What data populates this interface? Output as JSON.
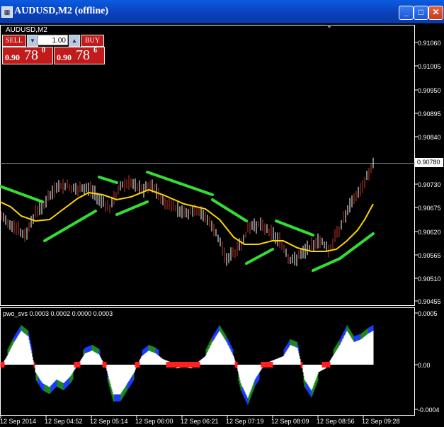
{
  "window": {
    "title": "AUDUSD,M2 (offline)",
    "minimize": "_",
    "maximize": "□",
    "close": "✕"
  },
  "symbol_label": "AUDUSD,M2",
  "one_click": {
    "sell_label": "SELL",
    "buy_label": "BUY",
    "lot": "1.00",
    "dropdown_icon": "▼",
    "up_icon": "▲",
    "sell_quote": {
      "big": "0.90",
      "pips": "78",
      "frac": "0"
    },
    "buy_quote": {
      "big": "0.90",
      "pips": "78",
      "frac": "6"
    }
  },
  "price_axis": [
    "0.91060",
    "0.91005",
    "0.90950",
    "0.90895",
    "0.90840",
    "0.90780",
    "0.90730",
    "0.90675",
    "0.90620",
    "0.90565",
    "0.90510",
    "0.90455"
  ],
  "current_price": "0.90780",
  "indicator": {
    "name": "pwo_svs 0.0003 0.0002 0.0000 0.0003",
    "axis": [
      "0.0005",
      "0.00",
      "-0.0004"
    ]
  },
  "time_axis": [
    "12 Sep 2014",
    "12 Sep 04:52",
    "12 Sep 05:14",
    "12 Sep 06:00",
    "12 Sep 06:21",
    "12 Sep 07:19",
    "12 Sep 08:09",
    "12 Sep 08:56",
    "12 Sep 09:28"
  ],
  "colors": {
    "candle": "#ffffff",
    "bear": "#c0392b",
    "ma": "#ffd400",
    "band": "#33dd33",
    "hist_pos": "#ffffff",
    "hist_red": "#ff2020",
    "hist_blue": "#1a3cff",
    "hist_green": "#1b8a1b"
  },
  "chart_data": [
    {
      "type": "line",
      "series": [
        {
          "values": [
            0.90675,
            0.90655,
            0.9064,
            0.907,
            0.9074,
            0.9072,
            0.9069,
            0.907,
            0.9073,
            0.90745,
            0.9073,
            0.907,
            0.9068,
            0.90655,
            0.906,
            0.9057,
            0.906,
            0.90625,
            0.906,
            0.9057,
            0.9056,
            0.9059,
            0.9061,
            0.9058,
            0.9064,
            0.907,
            0.9074,
            0.90782
          ]
        }
      ]
    },
    {
      "type": "bar",
      "ylim": [
        -0.0004,
        0.0005
      ]
    }
  ]
}
